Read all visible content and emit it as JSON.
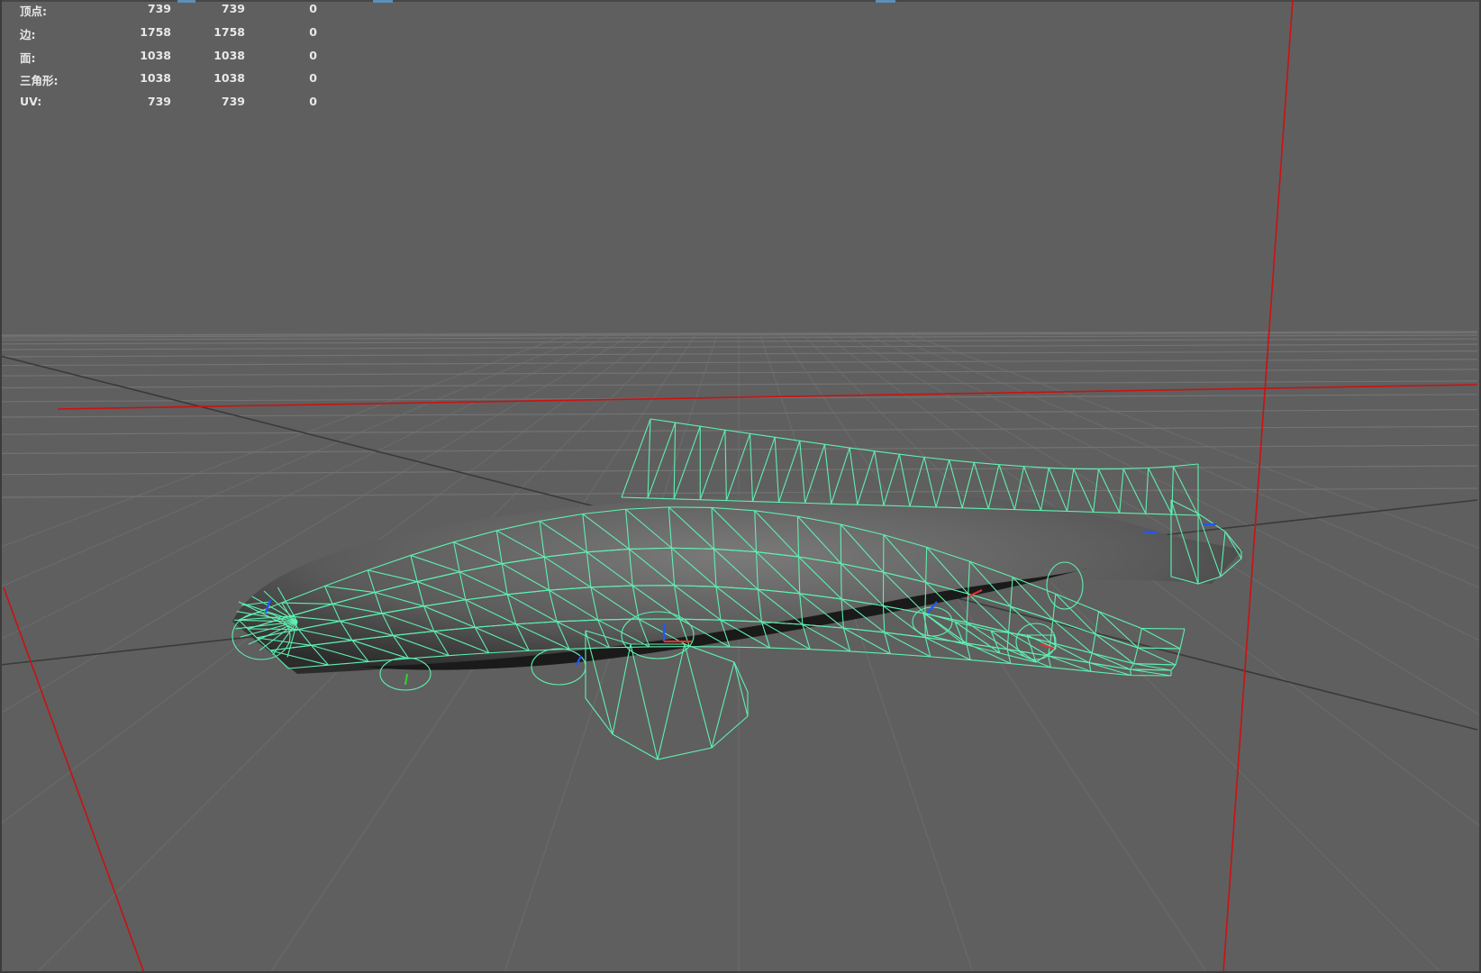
{
  "heads_up_display": {
    "poly_count": [
      {
        "label": "顶点:",
        "total": "739",
        "selected": "739",
        "selected_extra": "0"
      },
      {
        "label": "边:",
        "total": "1758",
        "selected": "1758",
        "selected_extra": "0"
      },
      {
        "label": "面:",
        "total": "1038",
        "selected": "1038",
        "selected_extra": "0"
      },
      {
        "label": "三角形:",
        "total": "1038",
        "selected": "1038",
        "selected_extra": "0"
      },
      {
        "label": "UV:",
        "total": "739",
        "selected": "739",
        "selected_extra": "0"
      }
    ]
  },
  "colors": {
    "viewport_background": "#5f5f5f",
    "wireframe_selected": "#5ff0b0",
    "camera_frustum": "#cc1111",
    "grid": "#737373",
    "grid_axis": "#3a3a3a"
  },
  "icons": {
    "mesh": "selected-mesh-wireframe",
    "joint_manipulators": "joint-axis-icon"
  }
}
